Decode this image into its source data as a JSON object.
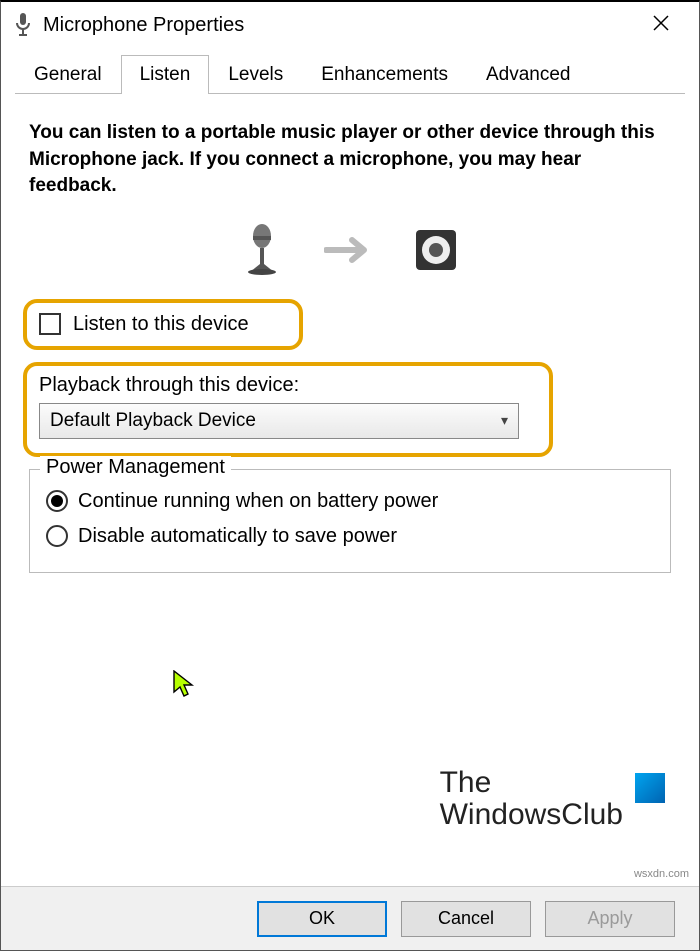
{
  "window": {
    "title": "Microphone Properties"
  },
  "tabs": {
    "items": [
      {
        "label": "General"
      },
      {
        "label": "Listen"
      },
      {
        "label": "Levels"
      },
      {
        "label": "Enhancements"
      },
      {
        "label": "Advanced"
      }
    ],
    "active_index": 1
  },
  "listen": {
    "description": "You can listen to a portable music player or other device through this Microphone jack.  If you connect a microphone, you may hear feedback.",
    "checkbox_label": "Listen to this device",
    "checkbox_checked": false,
    "playback_label": "Playback through this device:",
    "playback_selected": "Default Playback Device"
  },
  "power": {
    "legend": "Power Management",
    "option_continue": "Continue running when on battery power",
    "option_disable": "Disable automatically to save power",
    "selected": "continue"
  },
  "buttons": {
    "ok": "OK",
    "cancel": "Cancel",
    "apply": "Apply"
  },
  "watermark": {
    "line1": "The",
    "line2": "WindowsClub",
    "small": "wsxdn.com"
  }
}
